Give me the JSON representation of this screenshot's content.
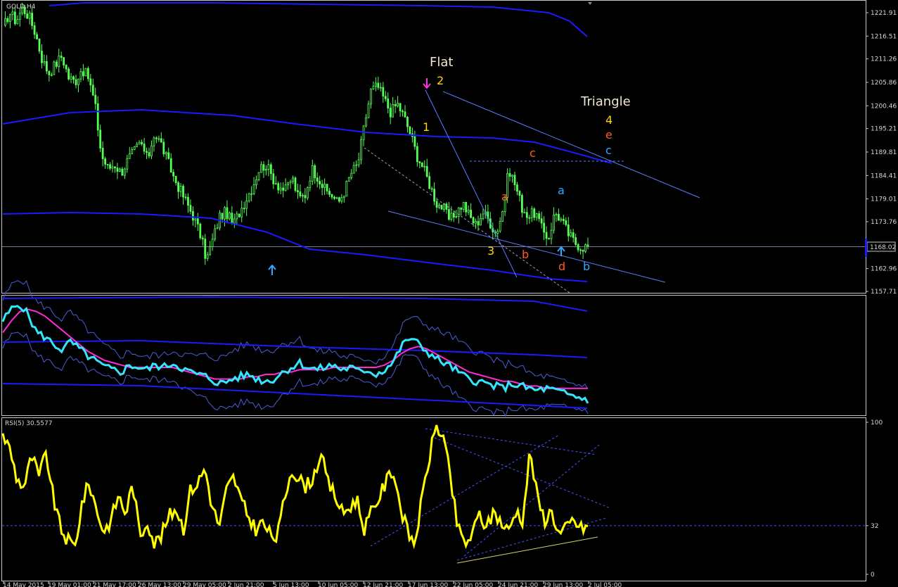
{
  "symbol_label": "GOLD,H4",
  "rsi_label": "RSI(5) 30.5577",
  "current_price": "1168.02",
  "colors": {
    "bg": "#000000",
    "grid": "#c8c8c8",
    "price": "#55ff55",
    "band": "#1a1aff",
    "trend": "#5a7cff",
    "cyan": "#33e5ff",
    "magenta": "#ff2bd6",
    "rsi": "#ffff00",
    "yellow_label": "#ffd400",
    "orange_label": "#ff5a1f",
    "blue_label": "#33a8ff",
    "white_label": "#f0e6d0"
  },
  "price_axis": {
    "ticks": [
      "1221.91",
      "1216.51",
      "1211.26",
      "1205.86",
      "1200.46",
      "1195.21",
      "1189.81",
      "1184.41",
      "1179.01",
      "1173.76",
      "1168.02",
      "1162.96",
      "1157.71"
    ]
  },
  "rsi_axis": {
    "ticks": [
      "100",
      "32",
      "0"
    ]
  },
  "time_axis": {
    "labels": [
      "14 May 2015",
      "19 May 01:00",
      "21 May 17:00",
      "26 May 13:00",
      "29 May 05:00",
      "2 Jun 21:00",
      "5 Jun 13:00",
      "10 Jun 05:00",
      "12 Jun 21:00",
      "17 Jun 13:00",
      "22 Jun 05:00",
      "24 Jun 21:00",
      "29 Jun 13:00",
      "2 Jul 05:00"
    ]
  },
  "annotations": {
    "flat": "Flat",
    "triangle": "Triangle",
    "w1": "1",
    "w2": "2",
    "w3": "3",
    "w4": "4",
    "we": "e",
    "wc_blue": "c",
    "wc_red": "c",
    "wa_red": "a",
    "wb_red": "b",
    "wa_blue": "a",
    "wb_blue": "b",
    "wd": "d"
  },
  "chart_data": [
    {
      "type": "candlestick",
      "title": "GOLD,H4",
      "ylim": [
        1156,
        1224
      ],
      "x_labels": [
        "14 May 2015",
        "19 May 01:00",
        "21 May 17:00",
        "26 May 13:00",
        "29 May 05:00",
        "2 Jun 21:00",
        "5 Jun 13:00",
        "10 Jun 05:00",
        "12 Jun 21:00",
        "17 Jun 13:00",
        "22 Jun 05:00",
        "24 Jun 21:00",
        "29 Jun 13:00",
        "2 Jul 05:00"
      ],
      "close_path": [
        1218,
        1222,
        1220,
        1223,
        1221,
        1217,
        1211,
        1208,
        1210,
        1212,
        1207,
        1206,
        1209,
        1207,
        1201,
        1189,
        1186,
        1187,
        1185,
        1188,
        1190,
        1192,
        1188,
        1194,
        1192,
        1188,
        1184,
        1181,
        1178,
        1175,
        1171,
        1165,
        1170,
        1175,
        1176,
        1173,
        1176,
        1179,
        1182,
        1186,
        1187,
        1184,
        1182,
        1181,
        1184,
        1179,
        1180,
        1186,
        1184,
        1181,
        1180,
        1178,
        1181,
        1185,
        1187,
        1196,
        1204,
        1205,
        1202,
        1199,
        1201,
        1198,
        1194,
        1189,
        1186,
        1182,
        1178,
        1177,
        1174,
        1176,
        1178,
        1175,
        1173,
        1176,
        1174,
        1171,
        1176,
        1186,
        1182,
        1177,
        1175,
        1176,
        1172,
        1170,
        1176,
        1174,
        1171,
        1169,
        1168,
        1168
      ]
    },
    {
      "type": "line",
      "title": "",
      "series": [
        {
          "values": [
            80,
            90,
            95,
            85,
            70,
            66,
            60,
            55,
            62,
            56,
            50,
            45,
            40,
            38,
            36,
            42,
            40,
            38,
            42,
            40,
            44,
            40,
            36,
            34,
            32,
            28,
            26,
            30,
            32,
            34,
            30,
            28,
            30,
            36,
            40,
            44,
            40,
            38,
            40,
            42,
            38,
            40,
            36,
            38,
            34,
            38,
            44,
            58,
            66,
            60,
            54,
            48,
            44,
            40,
            34,
            30,
            28,
            26,
            24,
            22,
            26,
            24,
            22,
            20,
            22,
            20,
            18,
            16,
            14,
            12
          ]
        },
        {
          "values": [
            70,
            80,
            88,
            90,
            88,
            84,
            78,
            72,
            66,
            60,
            54,
            50,
            46,
            44,
            42,
            40,
            40,
            40,
            40,
            40,
            40,
            38,
            36,
            34,
            32,
            30,
            30,
            30,
            30,
            32,
            32,
            34,
            34,
            36,
            36,
            38,
            38,
            38,
            38,
            40,
            40,
            40,
            40,
            40,
            40,
            42,
            46,
            52,
            56,
            58,
            56,
            52,
            48,
            44,
            40,
            36,
            34,
            32,
            30,
            28,
            28,
            26,
            24,
            24,
            22,
            22,
            22,
            22,
            22,
            22
          ]
        }
      ]
    },
    {
      "type": "line",
      "title": "RSI(5) 30.5577",
      "ylim": [
        0,
        100
      ],
      "series": [
        {
          "values": [
            92,
            82,
            62,
            58,
            78,
            64,
            80,
            50,
            30,
            22,
            18,
            48,
            60,
            42,
            28,
            36,
            52,
            40,
            60,
            24,
            36,
            20,
            26,
            38,
            44,
            30,
            56,
            60,
            70,
            44,
            32,
            56,
            64,
            48,
            38,
            30,
            34,
            26,
            24,
            50,
            70,
            62,
            58,
            64,
            80,
            60,
            52,
            40,
            44,
            50,
            30,
            40,
            50,
            60,
            70,
            46,
            28,
            20,
            48,
            76,
            98,
            90,
            62,
            30,
            20,
            26,
            40,
            30,
            42,
            34,
            28,
            42,
            36,
            82,
            50,
            36,
            42,
            26,
            30,
            36,
            30,
            32
          ]
        }
      ]
    }
  ]
}
